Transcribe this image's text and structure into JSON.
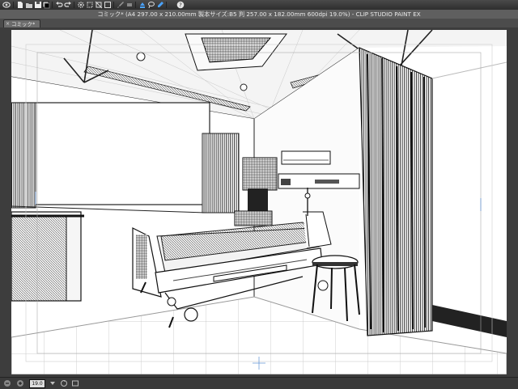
{
  "title": {
    "text": "コミック* (A4 297.00 x 210.00mm 製本サイズ:B5 判 257.00 x 182.00mm 600dpi 19.0%)  - CLIP STUDIO PAINT EX"
  },
  "tab": {
    "label": "コミック*"
  },
  "status": {
    "zoom": "19.0"
  },
  "toolbar": {
    "icons": [
      "app-menu-icon",
      "new-icon",
      "open-icon",
      "save-icon",
      "undo-icon",
      "redo-icon",
      "gear-icon",
      "transform-icon",
      "crop-icon",
      "brush-icon",
      "eraser-icon",
      "fill-icon",
      "lasso-icon",
      "eyedrop-icon",
      "help-icon"
    ]
  },
  "colors": {
    "toolbar": "#2e2e2e",
    "titlebar": "#5f5f5f",
    "canvas": "#ffffff",
    "frame": "#3d3d3d",
    "accent": "#3a8fd8"
  }
}
